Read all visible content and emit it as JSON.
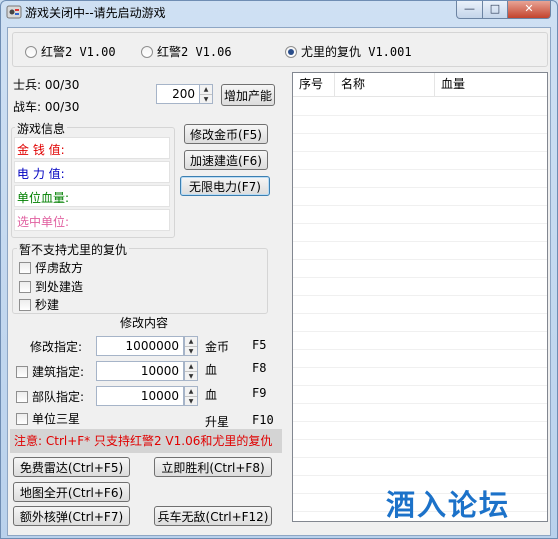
{
  "window": {
    "title": "游戏关闭中--请先启动游戏",
    "controls": {
      "minimize": "—",
      "maximize": "□",
      "close": "✕"
    }
  },
  "versions": {
    "options": [
      "红警2 V1.00",
      "红警2 V1.06",
      "尤里的复仇 V1.001"
    ],
    "selected": "尤里的复仇 V1.001"
  },
  "units": {
    "soldier_label": "士兵: 00/30",
    "tank_label": "战车: 00/30",
    "production_value": "200",
    "increase_button": "增加产能"
  },
  "game_info": {
    "title": "游戏信息",
    "money_label": "金 钱 值:",
    "power_label": "电 力 值:",
    "unit_hp_label": "单位血量:",
    "selected_unit_label": "选中单位:",
    "colors": {
      "money": "#e00000",
      "power": "#0000c0",
      "hp": "#008000",
      "selected": "#e060a0"
    }
  },
  "actions": {
    "modify_gold": "修改金币(F5)",
    "speed_build": "加速建造(F6)",
    "infinite_power": "无限电力(F7)"
  },
  "unsupported": {
    "title": "暂不支持尤里的复仇",
    "items": [
      "俘虏敌方",
      "到处建造",
      "秒建"
    ]
  },
  "modify": {
    "title": "修改内容",
    "rows": [
      {
        "label": "修改指定:",
        "value": "1000000",
        "unit": "金币",
        "key": "F5",
        "has_checkbox": false
      },
      {
        "label": "建筑指定:",
        "value": "10000",
        "unit": "血",
        "key": "F8",
        "has_checkbox": true
      },
      {
        "label": "部队指定:",
        "value": "10000",
        "unit": "血",
        "key": "F9",
        "has_checkbox": true
      }
    ],
    "three_star_label": "单位三星",
    "upgrade_label": "升星",
    "upgrade_key": "F10"
  },
  "notice": "注意: Ctrl+F* 只支持红警2 V1.06和尤里的复仇",
  "bottom_buttons": {
    "free_radar": "免费雷达(Ctrl+F5)",
    "instant_win": "立即胜利(Ctrl+F8)",
    "map_reveal": "地图全开(Ctrl+F6)",
    "extra_nuke": "额外核弹(Ctrl+F7)",
    "invincible": "兵车无敌(Ctrl+F12)"
  },
  "list": {
    "columns": [
      "序号",
      "名称",
      "血量"
    ],
    "rows": []
  },
  "watermark": "酒入论坛"
}
